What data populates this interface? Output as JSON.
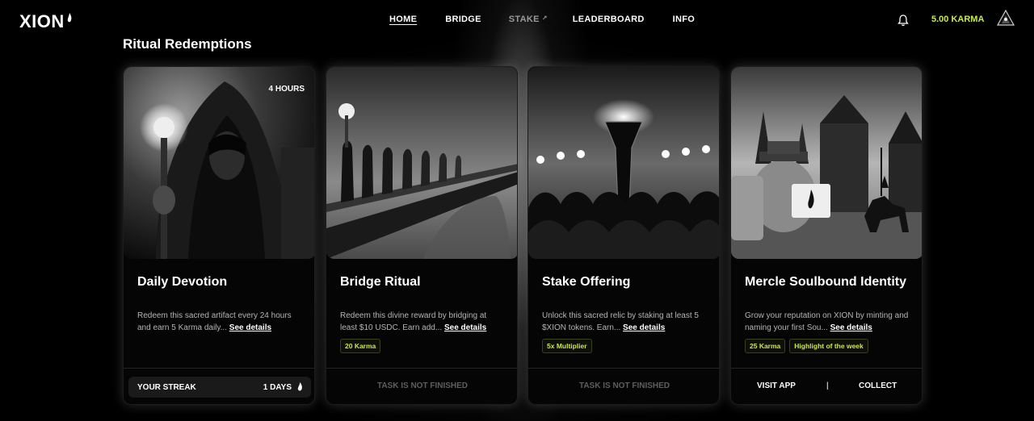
{
  "header": {
    "logo": "XION",
    "nav": [
      {
        "label": "HOME"
      },
      {
        "label": "BRIDGE"
      },
      {
        "label": "STAKE",
        "external": "↗"
      },
      {
        "label": "LEADERBOARD"
      },
      {
        "label": "INFO"
      }
    ],
    "karma": "5.00 KARMA",
    "accent_color": "#c9e84c"
  },
  "section_title": "Ritual Redemptions",
  "cards": [
    {
      "duration": "4 HOURS",
      "title": "Daily Devotion",
      "description": "Redeem this sacred artifact every 24 hours and earn 5 Karma daily...",
      "see_details": "See details",
      "streak_label": "YOUR STREAK",
      "streak_value": "1 DAYS",
      "image": "hooded-figure-with-torch"
    },
    {
      "title": "Bridge Ritual",
      "description": "Redeem this divine reward by bridging at least $10 USDC. Earn add...",
      "see_details": "See details",
      "tags": [
        "20 Karma"
      ],
      "status": "TASK IS NOT FINISHED",
      "image": "procession-on-bridge"
    },
    {
      "title": "Stake Offering",
      "description": "Unlock this sacred relic by staking at least 5 $XION tokens. Earn...",
      "see_details": "See details",
      "tags": [
        "5x Multiplier"
      ],
      "status": "TASK IS NOT FINISHED",
      "image": "torch-crowd"
    },
    {
      "title": "Mercle Soulbound Identity",
      "description": "Grow your reputation on XION by minting and naming your first Sou...",
      "see_details": "See details",
      "tags": [
        "25 Karma",
        "Highlight of the week"
      ],
      "visit_label": "VISIT APP",
      "separator": "|",
      "collect_label": "COLLECT",
      "image": "medieval-city-character"
    }
  ]
}
